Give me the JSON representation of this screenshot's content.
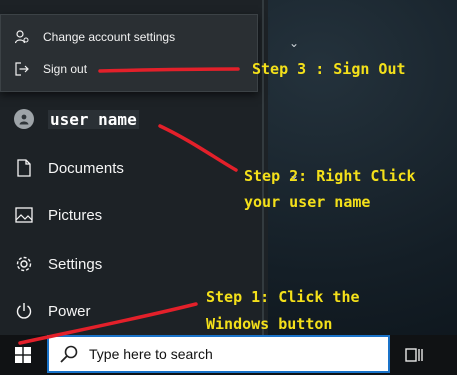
{
  "flyout": {
    "change_account": "Change account settings",
    "sign_out": "Sign out"
  },
  "start_menu": {
    "user": "user name",
    "items": [
      {
        "label": "Documents",
        "icon": "document-icon"
      },
      {
        "label": "Pictures",
        "icon": "pictures-icon"
      },
      {
        "label": "Settings",
        "icon": "gear-icon"
      },
      {
        "label": "Power",
        "icon": "power-icon"
      }
    ]
  },
  "taskbar": {
    "search_placeholder": "Type here to search"
  },
  "annotations": {
    "step3": "Step 3 : Sign Out",
    "step2_line1": "Step 2: Right Click",
    "step2_line2": "your user name",
    "step1_line1": "Step 1: Click the",
    "step1_line2": "Windows button",
    "color": "#f4e01a",
    "line_color": "#e3202a"
  }
}
